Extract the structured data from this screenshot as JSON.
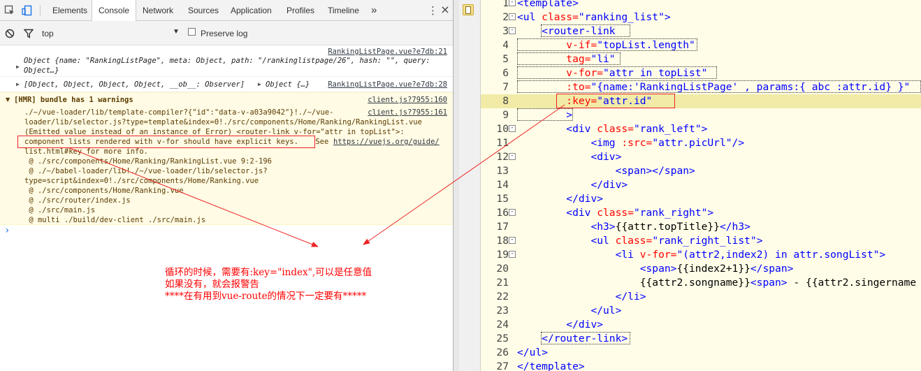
{
  "devtools": {
    "tabs": [
      "Elements",
      "Console",
      "Network",
      "Sources",
      "Application",
      "Profiles",
      "Timeline"
    ],
    "active_tab": "Console",
    "more_tabs": "»",
    "filter_context": "top",
    "preserve_log": "Preserve log",
    "messages": [
      {
        "source": "RankingListPage.vue?e7db:21",
        "line1_prefix": "Object {",
        "line1_body": "name: \"RankingListPage\", meta: Object, path: \"/rankinglistpage/26\", hash: \"\", query:",
        "line2": "Object…}"
      },
      {
        "source": "RankingListPage.vue?e7db:28",
        "text": "[Object, Object, Object, Object, __ob__: Observer]",
        "extra": "Object {…}"
      }
    ],
    "warning": {
      "header": "[HMR] bundle has 1 warnings",
      "header_source": "client.js?7955:160",
      "body_source": "client.js?7955:161",
      "lines": [
        "./~/vue-loader/lib/template-compiler?{\"id\":\"data-v-a03a9042\"}!./~/vue-",
        "loader/lib/selector.js?type=template&index=0!./src/components/Home/Ranking/RankingList.vue",
        "(Emitted value instead of an instance of Error) <router-link v-for=\"attr in topList\">:",
        "component lists rendered with v-for should have explicit keys.",
        "list.html#key for more info.",
        " @ ./src/components/Home/Ranking/RankingList.vue 9:2-196",
        " @ ./~/babel-loader/lib!./~/vue-loader/lib/selector.js?",
        "type=script&index=0!./src/components/Home/Ranking.vue",
        " @ ./src/components/Home/Ranking.vue",
        " @ ./src/router/index.js",
        " @ ./src/main.js",
        " @ multi ./build/dev-client ./src/main.js"
      ],
      "see": " See ",
      "link": "https://vuejs.org/guide/"
    },
    "prompt": "›"
  },
  "annotation": {
    "line1": "循环的时候，需要有:key=\"index\",可以是任意值",
    "line2": "如果没有，就会报警告",
    "line3": "****在有用到vue-route的情况下一定要有*****",
    "color": "#ff0000"
  },
  "editor": {
    "lines": [
      {
        "n": "1",
        "fold": "-",
        "parts": [
          [
            "tg",
            "<template>"
          ]
        ]
      },
      {
        "n": "2",
        "fold": "-",
        "parts": [
          [
            "tg",
            "<ul "
          ],
          [
            "at",
            "class="
          ],
          [
            "vl",
            "\"ranking_list\""
          ],
          [
            "tg",
            ">"
          ]
        ]
      },
      {
        "n": "3",
        "fold": "-",
        "parts": [
          [
            "tx",
            "    "
          ],
          [
            "tg",
            "<router-link"
          ]
        ]
      },
      {
        "n": "4",
        "fold": "",
        "parts": [
          [
            "tx",
            "        "
          ],
          [
            "at",
            "v-if="
          ],
          [
            "vl",
            "\"topList.length\""
          ]
        ]
      },
      {
        "n": "5",
        "fold": "",
        "parts": [
          [
            "tx",
            "        "
          ],
          [
            "at",
            "tag="
          ],
          [
            "vl",
            "\"li\""
          ]
        ]
      },
      {
        "n": "6",
        "fold": "",
        "parts": [
          [
            "tx",
            "        "
          ],
          [
            "at",
            "v-for="
          ],
          [
            "vl",
            "\"attr in topList\""
          ]
        ]
      },
      {
        "n": "7",
        "fold": "",
        "parts": [
          [
            "tx",
            "        "
          ],
          [
            "at",
            ":to="
          ],
          [
            "vl",
            "\"{name:'RankingListPage' , params:{ abc :attr.id} }\""
          ]
        ]
      },
      {
        "n": "8",
        "fold": "",
        "parts": [
          [
            "tx",
            "        "
          ],
          [
            "at",
            ":key="
          ],
          [
            "vl",
            "\"attr.id\""
          ]
        ]
      },
      {
        "n": "9",
        "fold": "",
        "parts": [
          [
            "tx",
            "        "
          ],
          [
            "tg",
            ">"
          ]
        ]
      },
      {
        "n": "10",
        "fold": "-",
        "parts": [
          [
            "tx",
            "        "
          ],
          [
            "tg",
            "<div "
          ],
          [
            "at",
            "class="
          ],
          [
            "vl",
            "\"rank_left\""
          ],
          [
            "tg",
            ">"
          ]
        ]
      },
      {
        "n": "11",
        "fold": "",
        "parts": [
          [
            "tx",
            "            "
          ],
          [
            "tg",
            "<img "
          ],
          [
            "at",
            ":src="
          ],
          [
            "vl",
            "\"attr.picUrl\""
          ],
          [
            "tg",
            "/>"
          ]
        ]
      },
      {
        "n": "12",
        "fold": "-",
        "parts": [
          [
            "tx",
            "            "
          ],
          [
            "tg",
            "<div>"
          ]
        ]
      },
      {
        "n": "13",
        "fold": "",
        "parts": [
          [
            "tx",
            "                "
          ],
          [
            "tg",
            "<span></span>"
          ]
        ]
      },
      {
        "n": "14",
        "fold": "",
        "parts": [
          [
            "tx",
            "            "
          ],
          [
            "tg",
            "</div>"
          ]
        ]
      },
      {
        "n": "15",
        "fold": "",
        "parts": [
          [
            "tx",
            "        "
          ],
          [
            "tg",
            "</div>"
          ]
        ]
      },
      {
        "n": "16",
        "fold": "-",
        "parts": [
          [
            "tx",
            "        "
          ],
          [
            "tg",
            "<div "
          ],
          [
            "at",
            "class="
          ],
          [
            "vl",
            "\"rank_right\""
          ],
          [
            "tg",
            ">"
          ]
        ]
      },
      {
        "n": "17",
        "fold": "",
        "parts": [
          [
            "tx",
            "            "
          ],
          [
            "tg",
            "<h3>"
          ],
          [
            "tx",
            "{{attr.topTitle}}"
          ],
          [
            "tg",
            "</h3>"
          ]
        ]
      },
      {
        "n": "18",
        "fold": "-",
        "parts": [
          [
            "tx",
            "            "
          ],
          [
            "tg",
            "<ul "
          ],
          [
            "at",
            "class="
          ],
          [
            "vl",
            "\"rank_right_list\""
          ],
          [
            "tg",
            ">"
          ]
        ]
      },
      {
        "n": "19",
        "fold": "-",
        "parts": [
          [
            "tx",
            "                "
          ],
          [
            "tg",
            "<li "
          ],
          [
            "at",
            "v-for="
          ],
          [
            "vl",
            "\"(attr2,index2) in attr.songList\""
          ],
          [
            "tg",
            ">"
          ]
        ]
      },
      {
        "n": "20",
        "fold": "",
        "parts": [
          [
            "tx",
            "                    "
          ],
          [
            "tg",
            "<span>"
          ],
          [
            "tx",
            "{{index2+1}}"
          ],
          [
            "tg",
            "</span>"
          ]
        ]
      },
      {
        "n": "21",
        "fold": "",
        "parts": [
          [
            "tx",
            "                    {{attr2.songname}}"
          ],
          [
            "tg",
            "<span>"
          ],
          [
            "tx",
            " - {{attr2.singername"
          ]
        ]
      },
      {
        "n": "22",
        "fold": "",
        "parts": [
          [
            "tx",
            "                "
          ],
          [
            "tg",
            "</li>"
          ]
        ]
      },
      {
        "n": "23",
        "fold": "",
        "parts": [
          [
            "tx",
            "            "
          ],
          [
            "tg",
            "</ul>"
          ]
        ]
      },
      {
        "n": "24",
        "fold": "",
        "parts": [
          [
            "tx",
            "        "
          ],
          [
            "tg",
            "</div>"
          ]
        ]
      },
      {
        "n": "25",
        "fold": "",
        "parts": [
          [
            "tx",
            "    "
          ],
          [
            "tg",
            "</router-link>"
          ]
        ]
      },
      {
        "n": "26",
        "fold": "",
        "parts": [
          [
            "tg",
            "</ul>"
          ]
        ]
      },
      {
        "n": "27",
        "fold": "",
        "parts": [
          [
            "tg",
            "</template>"
          ]
        ]
      }
    ]
  }
}
